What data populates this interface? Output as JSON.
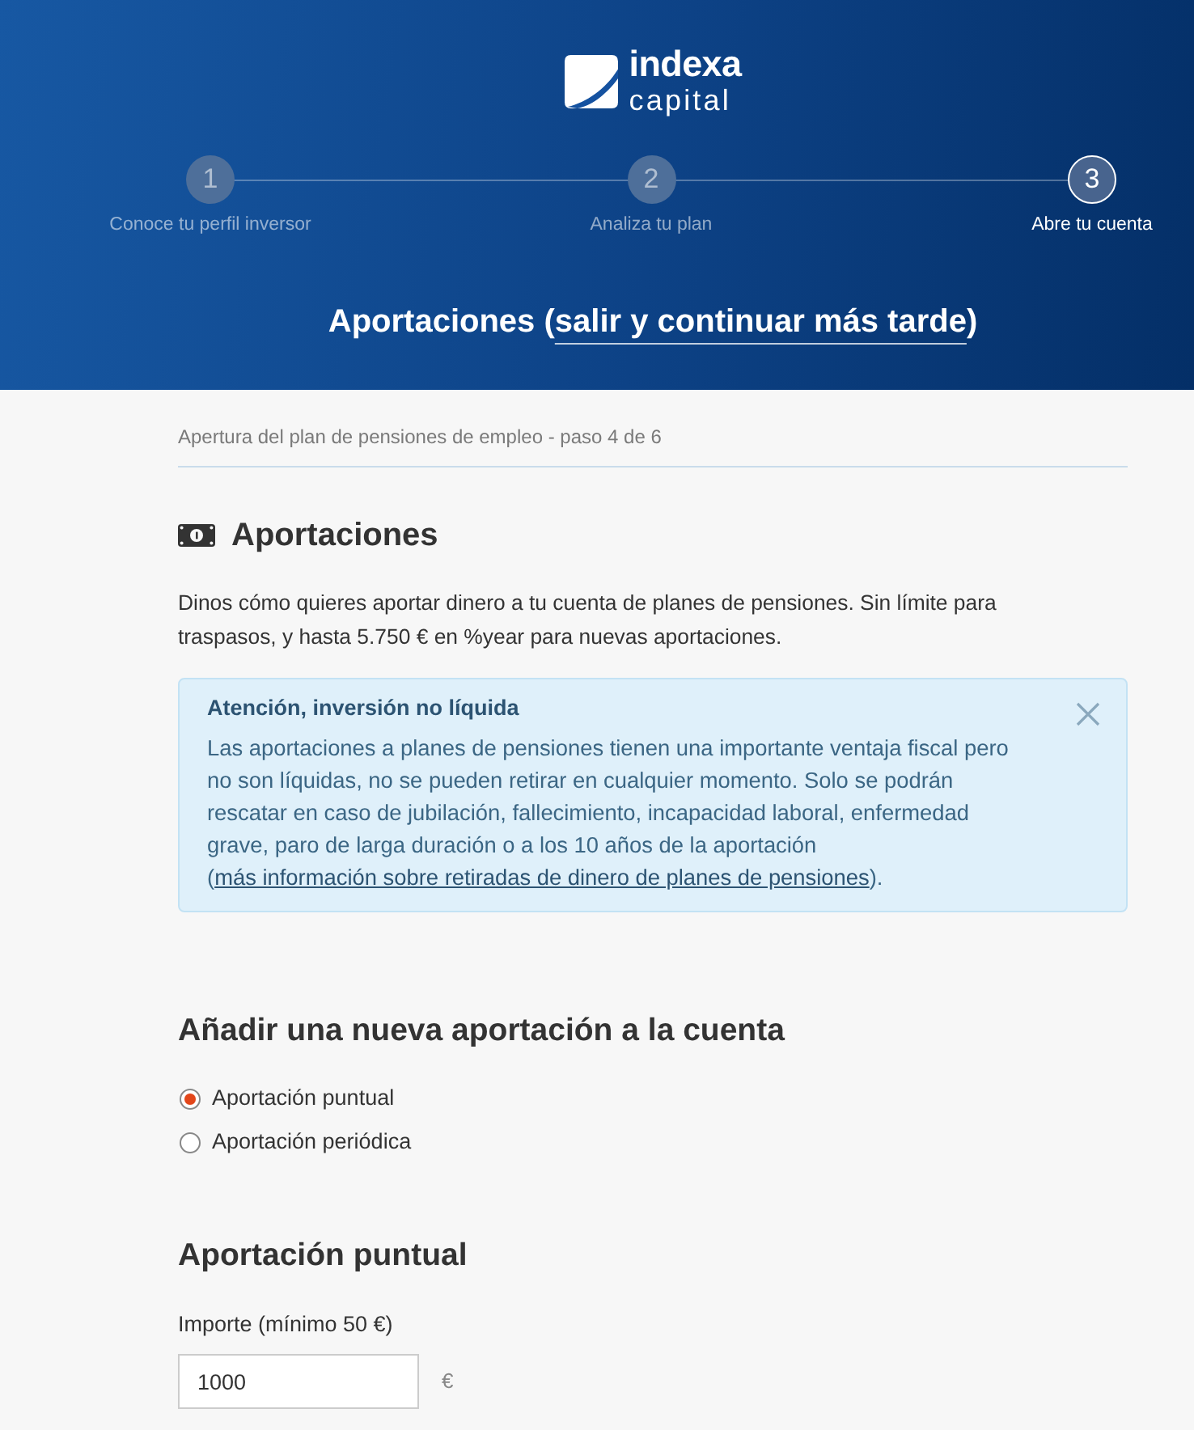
{
  "header": {
    "logo": {
      "name": "indexa",
      "tagline": "capital"
    },
    "steps": [
      {
        "number": "1",
        "label": "Conoce tu perfil inversor",
        "selected": false
      },
      {
        "number": "2",
        "label": "Analiza tu plan",
        "selected": false
      },
      {
        "number": "3",
        "label": "Abre tu cuenta",
        "selected": true
      }
    ],
    "title": {
      "text": "Aportaciones (",
      "link": "salir y continuar más tarde",
      "suffix": ")"
    }
  },
  "breadcrumb": "Apertura del plan de pensiones de empleo - paso 4 de 6",
  "section": {
    "title": "Aportaciones",
    "intro": "Dinos cómo quieres aportar dinero a tu cuenta de planes de pensiones. Sin límite para traspasos, y hasta 5.750 € en %year para nuevas aportaciones."
  },
  "alert": {
    "title": "Atención, inversión no líquida",
    "text": "Las aportaciones a planes de pensiones tienen una importante ventaja fiscal pero no son líquidas, no se pueden retirar en cualquier momento. Solo se podrán rescatar en caso de jubilación, fallecimiento, incapacidad laboral, enfermedad grave, paro de larga duración o a los 10 años de la aportación (",
    "link": "más información sobre retiradas de dinero de planes de pensiones",
    "suffix": ")."
  },
  "new_contribution": {
    "title": "Añadir una nueva aportación a la cuenta",
    "options": [
      {
        "label": "Aportación puntual",
        "selected": true
      },
      {
        "label": "Aportación periódica",
        "selected": false
      }
    ]
  },
  "one_off": {
    "title": "Aportación puntual",
    "amount": {
      "label": "Importe (mínimo 50 €)",
      "value": "1000",
      "unit": "€"
    }
  }
}
